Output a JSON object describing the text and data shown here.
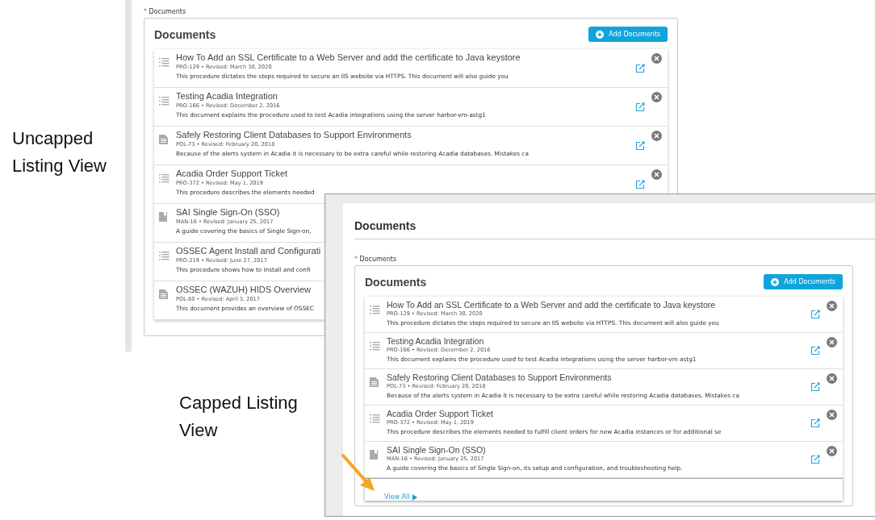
{
  "annotations": [
    {
      "text": "Uncapped Listing View"
    },
    {
      "text": "Capped Listing View"
    }
  ],
  "views": [
    {
      "kind": "uncapped",
      "required_mark": "*",
      "field_label": "Documents",
      "panel_title": "Documents",
      "add_button": "Add Documents",
      "documents": [
        {
          "kind": "procedure",
          "title": "How To Add an SSL Certificate to a Web Server and add the certificate to Java keystore",
          "meta": "PRO-129 • Revised: March 30, 2020",
          "summary": "This procedure dictates the steps required to secure an IIS website via HTTPS.  This document will also guide you"
        },
        {
          "kind": "procedure",
          "title": "Testing Acadia Integration",
          "meta": "PRO-166 • Revised: December 2, 2016",
          "summary": "This document explains the procedure used to test Acadia integrations using the server harbor-vm-astg1"
        },
        {
          "kind": "policy",
          "title": "Safely Restoring Client Databases to Support Environments",
          "meta": "POL-73 • Revised: February 20, 2018",
          "summary": "Because of the alerts system in Acadia it is necessary to be extra careful while restoring Acadia databases. Mistakes ca"
        },
        {
          "kind": "procedure",
          "title": "Acadia Order Support Ticket",
          "meta": "PRO-372 • Revised: May 1, 2019",
          "summary": "This procedure describes the elements needed"
        },
        {
          "kind": "manual",
          "title": "SAI Single Sign-On (SSO)",
          "meta": "MAN-16 • Revised: January 25, 2017",
          "summary": "A guide covering the basics of Single Sign-on,"
        },
        {
          "kind": "procedure",
          "title": "OSSEC Agent Install and Configurati",
          "meta": "PRO-219 • Revised: June 27, 2017",
          "summary": "This procedure shows how to install and confi"
        },
        {
          "kind": "policy",
          "title": "OSSEC (WAZUH) HIDS Overview",
          "meta": "POL-80 • Revised: April 3, 2017",
          "summary": "This document provides an overview of OSSEC"
        }
      ]
    },
    {
      "kind": "capped",
      "page_title": "Documents",
      "required_mark": "*",
      "field_label": "Documents",
      "panel_title": "Documents",
      "add_button": "Add Documents",
      "view_all": "View All",
      "documents": [
        {
          "kind": "procedure",
          "title": "How To Add an SSL Certificate to a Web Server and add the certificate to Java keystore",
          "meta": "PRO-129 • Revised: March 30, 2020",
          "summary": "This procedure dictates the steps required to secure an IIS website via HTTPS.  This document will also guide you"
        },
        {
          "kind": "procedure",
          "title": "Testing Acadia Integration",
          "meta": "PRO-166 • Revised: December 2, 2016",
          "summary": "This document explains the procedure used to test Acadia integrations using the server harbor-vm astg1"
        },
        {
          "kind": "policy",
          "title": "Safely Restoring Client Databases to Support Environments",
          "meta": "POL-73 • Revised: February 20, 2018",
          "summary": "Because of the alerts system in Acadia it is necessary to be extra careful while restoring Acadia databases. Mistakes ca"
        },
        {
          "kind": "procedure",
          "title": "Acadia Order Support Ticket",
          "meta": "PRO-372 • Revised: May 1, 2019",
          "summary": "This procedure describes the elements needed to fulfill client orders for new Acadia instances or for additional se"
        },
        {
          "kind": "manual",
          "title": "SAI Single Sign-On (SSO)",
          "meta": "MAN-16 • Revised: January 25, 2017",
          "summary": "A guide covering the basics of Single Sign-on, its setup and configuration, and troubleshooting help."
        }
      ]
    }
  ]
}
